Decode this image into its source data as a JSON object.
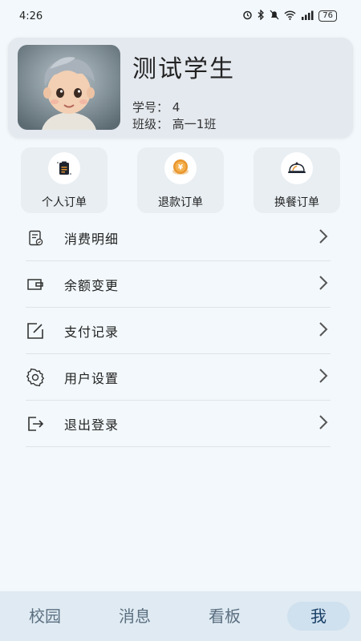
{
  "status_bar": {
    "time": "4:26",
    "battery": "76"
  },
  "profile": {
    "name": "测试学生",
    "student_id_label": "学号：",
    "student_id": "4",
    "class_label": "班级：",
    "class_name": "高一1班"
  },
  "quick_actions": [
    {
      "label": "个人订单",
      "icon": "order-icon"
    },
    {
      "label": "退款订单",
      "icon": "refund-coin-icon"
    },
    {
      "label": "换餐订单",
      "icon": "food-cloche-icon"
    }
  ],
  "menu": [
    {
      "label": "消费明细",
      "icon": "receipt-icon"
    },
    {
      "label": "余额变更",
      "icon": "wallet-icon"
    },
    {
      "label": "支付记录",
      "icon": "edit-icon"
    },
    {
      "label": "用户设置",
      "icon": "gear-icon"
    },
    {
      "label": "退出登录",
      "icon": "logout-icon"
    }
  ],
  "bottom_nav": [
    {
      "label": "校园",
      "active": false
    },
    {
      "label": "消息",
      "active": false
    },
    {
      "label": "看板",
      "active": false
    },
    {
      "label": "我",
      "active": true
    }
  ],
  "colors": {
    "background": "#f2f8fb",
    "card": "#e4e9ef",
    "nav_bg": "#dfeaf2",
    "nav_active": "#cfe0ee",
    "refund_orange": "#e8962e"
  }
}
